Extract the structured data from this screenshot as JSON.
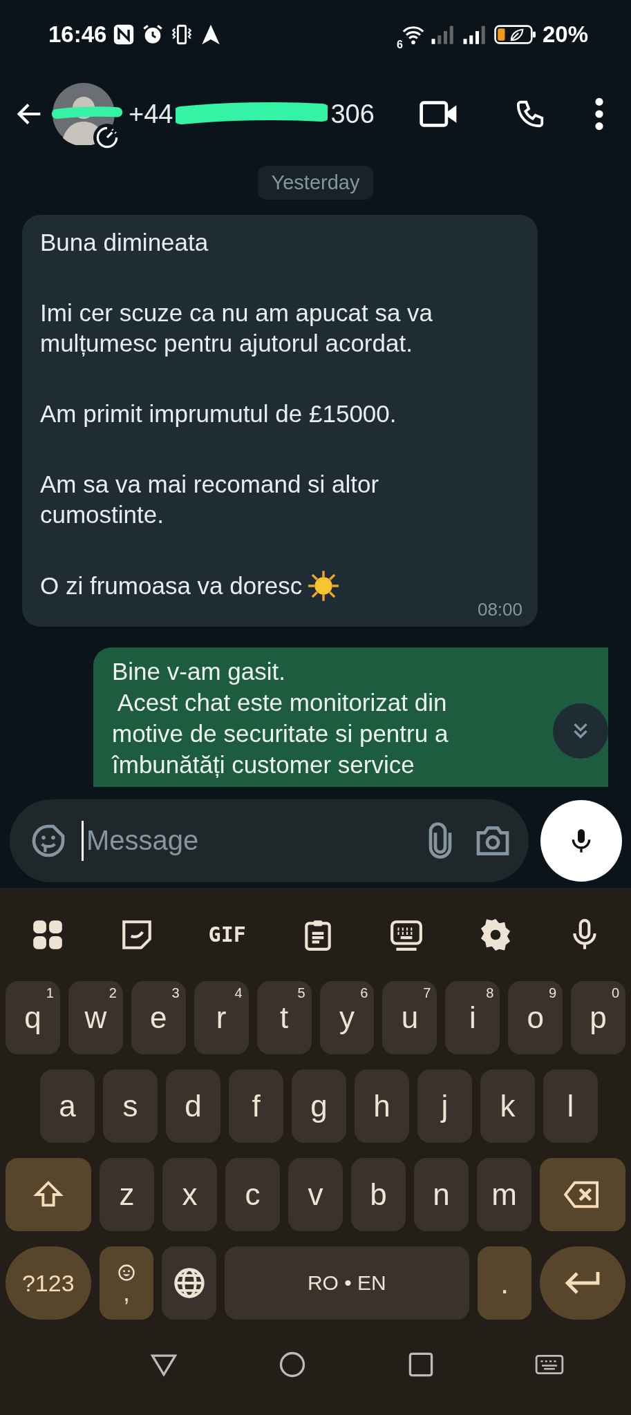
{
  "status_bar": {
    "time": "16:46",
    "wifi_label": "6",
    "battery": "20%"
  },
  "header": {
    "number_start": "+44",
    "number_end": "306"
  },
  "date_chip": "Yesterday",
  "messages": [
    {
      "kind": "incoming",
      "paragraphs": [
        "Buna dimineata",
        "Imi cer scuze ca nu am apucat sa va\nmulțumesc pentru ajutorul acordat.",
        "Am primit imprumutul de £15000.",
        "Am sa va mai recomand si altor\ncumostinte.",
        "O zi frumoasa va doresc"
      ],
      "time": "08:00"
    },
    {
      "kind": "outgoing",
      "paragraphs": [
        "Bine v-am gasit.\n Acest chat este monitorizat din\nmotive de securitate si pentru a\nîmbunătăți customer service"
      ]
    }
  ],
  "composer": {
    "placeholder": "Message"
  },
  "keyboard": {
    "toolbar": [
      {
        "kind": "apps"
      },
      {
        "kind": "sticker"
      },
      {
        "kind": "gif",
        "label": "GIF"
      },
      {
        "kind": "clipboard"
      },
      {
        "kind": "keyboard"
      },
      {
        "kind": "settings"
      },
      {
        "kind": "mic"
      }
    ],
    "rows": [
      {
        "keys": [
          {
            "kind": "letter",
            "label": "q",
            "hint": "1"
          },
          {
            "kind": "letter",
            "label": "w",
            "hint": "2"
          },
          {
            "kind": "letter",
            "label": "e",
            "hint": "3"
          },
          {
            "kind": "letter",
            "label": "r",
            "hint": "4"
          },
          {
            "kind": "letter",
            "label": "t",
            "hint": "5"
          },
          {
            "kind": "letter",
            "label": "y",
            "hint": "6"
          },
          {
            "kind": "letter",
            "label": "u",
            "hint": "7"
          },
          {
            "kind": "letter",
            "label": "i",
            "hint": "8"
          },
          {
            "kind": "letter",
            "label": "o",
            "hint": "9"
          },
          {
            "kind": "letter",
            "label": "p",
            "hint": "0"
          }
        ]
      },
      {
        "keys": [
          {
            "kind": "letter",
            "label": "a"
          },
          {
            "kind": "letter",
            "label": "s"
          },
          {
            "kind": "letter",
            "label": "d"
          },
          {
            "kind": "letter",
            "label": "f"
          },
          {
            "kind": "letter",
            "label": "g"
          },
          {
            "kind": "letter",
            "label": "h"
          },
          {
            "kind": "letter",
            "label": "j"
          },
          {
            "kind": "letter",
            "label": "k"
          },
          {
            "kind": "letter",
            "label": "l"
          }
        ]
      },
      {
        "keys": [
          {
            "kind": "shift"
          },
          {
            "kind": "letter",
            "label": "z"
          },
          {
            "kind": "letter",
            "label": "x"
          },
          {
            "kind": "letter",
            "label": "c"
          },
          {
            "kind": "letter",
            "label": "v"
          },
          {
            "kind": "letter",
            "label": "b"
          },
          {
            "kind": "letter",
            "label": "n"
          },
          {
            "kind": "letter",
            "label": "m"
          },
          {
            "kind": "backspace"
          }
        ]
      },
      {
        "keys": [
          {
            "kind": "symbols",
            "label": "?123"
          },
          {
            "kind": "emoji",
            "label": ","
          },
          {
            "kind": "globe"
          },
          {
            "kind": "space",
            "label": "RO • EN"
          },
          {
            "kind": "period",
            "label": "."
          },
          {
            "kind": "enter"
          }
        ]
      }
    ]
  }
}
